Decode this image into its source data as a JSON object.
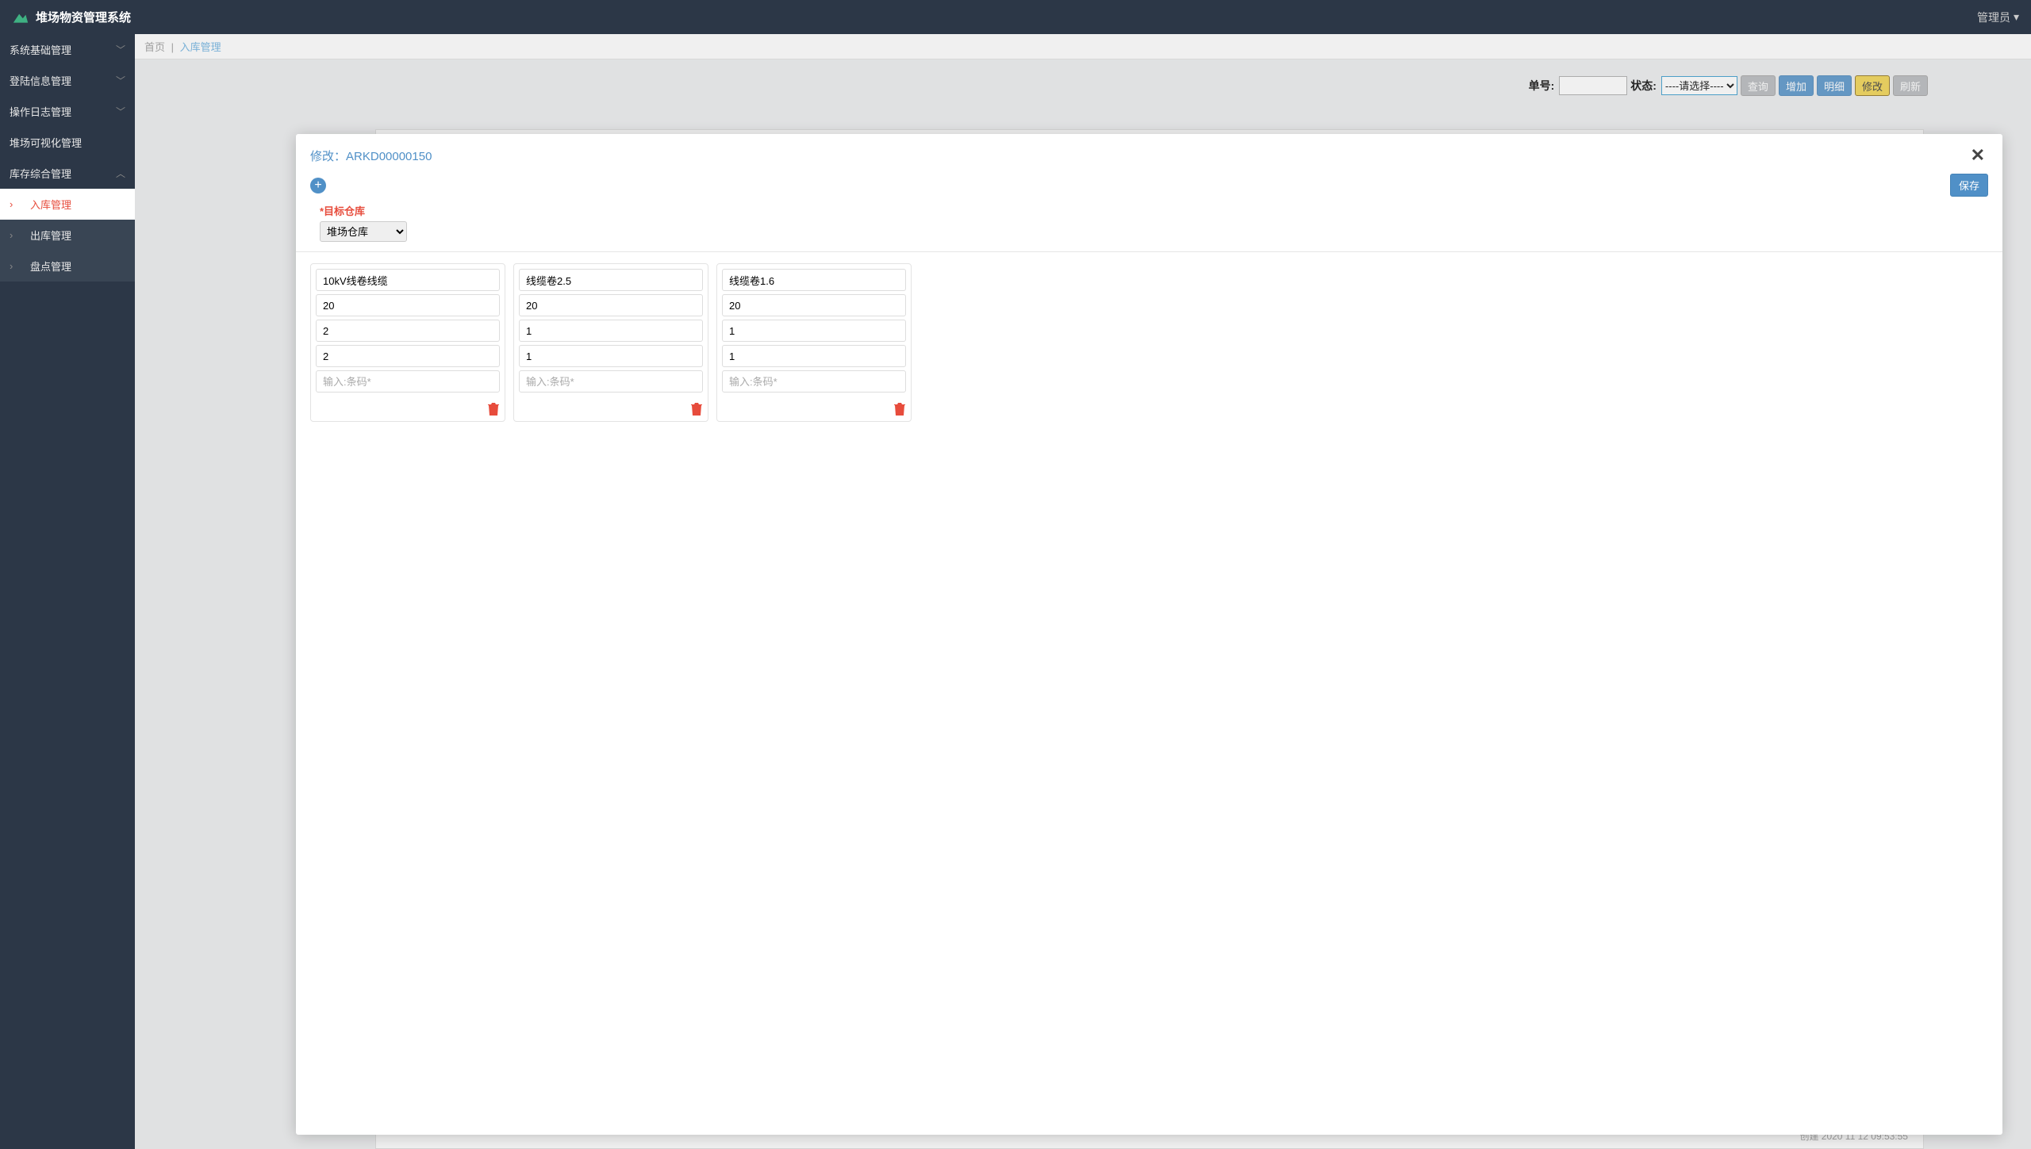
{
  "app": {
    "title": "堆场物资管理系统"
  },
  "user": {
    "label": "管理员"
  },
  "sidebar": {
    "items": [
      {
        "label": "系统基础管理",
        "expandable": true
      },
      {
        "label": "登陆信息管理",
        "expandable": true
      },
      {
        "label": "操作日志管理",
        "expandable": true
      },
      {
        "label": "堆场可视化管理",
        "expandable": false
      },
      {
        "label": "库存综合管理",
        "expandable": true,
        "expanded": true
      }
    ],
    "subitems": [
      {
        "label": "入库管理",
        "active": true
      },
      {
        "label": "出库管理",
        "active": false
      },
      {
        "label": "盘点管理",
        "active": false
      }
    ]
  },
  "breadcrumb": {
    "home": "首页",
    "current": "入库管理"
  },
  "toolbar": {
    "order_label": "单号:",
    "order_value": "",
    "status_label": "状态:",
    "status_placeholder": "----请选择----",
    "btn_query": "查询",
    "btn_add": "增加",
    "btn_detail": "明细",
    "btn_modify": "修改",
    "btn_refresh": "刷新"
  },
  "modal": {
    "title_prefix": "修改：",
    "title_id": "ARKD00000150",
    "save_label": "保存",
    "target_label": "*目标仓库",
    "target_value": "堆场仓库",
    "barcode_placeholder": "输入:条码*",
    "cards": [
      {
        "name": "10kV线卷线缆",
        "f2": "20",
        "f3": "2",
        "f4": "2"
      },
      {
        "name": "线缆卷2.5",
        "f2": "20",
        "f3": "1",
        "f4": "1"
      },
      {
        "name": "线缆卷1.6",
        "f2": "20",
        "f3": "1",
        "f4": "1"
      }
    ]
  },
  "bg_footer": "创建   2020 11 12 09:53:55"
}
